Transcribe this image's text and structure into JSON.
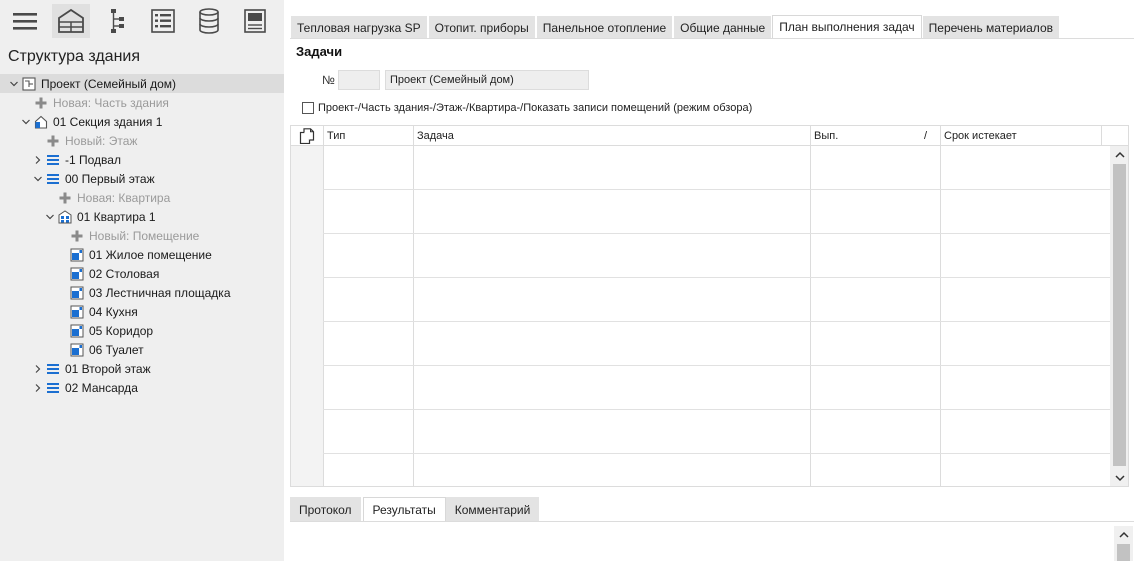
{
  "sidebar": {
    "title": "Структура здания",
    "toolbar": [
      {
        "icon": "menu-icon"
      },
      {
        "icon": "building-icon"
      },
      {
        "icon": "hierarchy-icon"
      },
      {
        "icon": "list-icon"
      },
      {
        "icon": "database-icon"
      },
      {
        "icon": "panel-icon"
      }
    ],
    "tree": [
      {
        "label": "Проект (Семейный дом)",
        "level": 0,
        "expand": "open",
        "icon": "project-icon",
        "selected": true
      },
      {
        "label": "Новая: Часть здания",
        "level": 1,
        "expand": "none",
        "icon": "plus-icon",
        "add": true
      },
      {
        "label": "01 Секция здания 1",
        "level": 1,
        "expand": "open",
        "icon": "house-icon"
      },
      {
        "label": "Новый: Этаж",
        "level": 2,
        "expand": "none",
        "icon": "plus-icon",
        "add": true
      },
      {
        "label": "-1 Подвал",
        "level": 2,
        "expand": "closed",
        "icon": "floor-icon"
      },
      {
        "label": "00 Первый этаж",
        "level": 2,
        "expand": "open",
        "icon": "floor-icon"
      },
      {
        "label": "Новая: Квартира",
        "level": 3,
        "expand": "none",
        "icon": "plus-icon",
        "add": true
      },
      {
        "label": "01 Квартира 1",
        "level": 3,
        "expand": "open",
        "icon": "apartment-icon"
      },
      {
        "label": "Новый: Помещение",
        "level": 4,
        "expand": "none",
        "icon": "plus-icon",
        "add": true
      },
      {
        "label": "01 Жилое помещение",
        "level": 4,
        "expand": "none",
        "icon": "room-icon"
      },
      {
        "label": "02 Столовая",
        "level": 4,
        "expand": "none",
        "icon": "room-icon"
      },
      {
        "label": "03 Лестничная площадка",
        "level": 4,
        "expand": "none",
        "icon": "room-icon"
      },
      {
        "label": "04 Кухня",
        "level": 4,
        "expand": "none",
        "icon": "room-icon"
      },
      {
        "label": "05 Коридор",
        "level": 4,
        "expand": "none",
        "icon": "room-icon"
      },
      {
        "label": "06 Туалет",
        "level": 4,
        "expand": "none",
        "icon": "room-icon"
      },
      {
        "label": "01 Второй этаж",
        "level": 2,
        "expand": "closed",
        "icon": "floor-icon"
      },
      {
        "label": "02 Мансарда",
        "level": 2,
        "expand": "closed",
        "icon": "floor-icon"
      }
    ]
  },
  "tabs": [
    {
      "label": "Тепловая нагрузка SP",
      "active": false
    },
    {
      "label": "Отопит. приборы",
      "active": false
    },
    {
      "label": "Панельное отопление",
      "active": false
    },
    {
      "label": "Общие данные",
      "active": false
    },
    {
      "label": "План выполнения задач",
      "active": true
    },
    {
      "label": "Перечень материалов",
      "active": false
    }
  ],
  "tasks": {
    "title": "Задачи",
    "number_label": "№",
    "number_value": "",
    "name_value": "Проект (Семейный дом)",
    "checkbox_label": "Проект-/Часть здания-/Этаж-/Квартира-/Показать записи помещений (режим обзора)",
    "checkbox_checked": false
  },
  "grid": {
    "columns": [
      {
        "label": "Тип"
      },
      {
        "label": "Задача"
      },
      {
        "label": "Вып."
      },
      {
        "label": "/"
      },
      {
        "label": "Срок истекает"
      }
    ],
    "row_count": 8
  },
  "bottom_tabs": [
    {
      "label": "Протокол",
      "active": false
    },
    {
      "label": "Результаты",
      "active": true
    },
    {
      "label": "Комментарий",
      "active": false
    }
  ],
  "colors": {
    "icon_blue": "#1b6fd1",
    "panel_bg": "#efefef",
    "selected_bg": "#dcdcdc",
    "tab_bg": "#e3e3e3",
    "disabled_text": "#9a9a9a"
  }
}
